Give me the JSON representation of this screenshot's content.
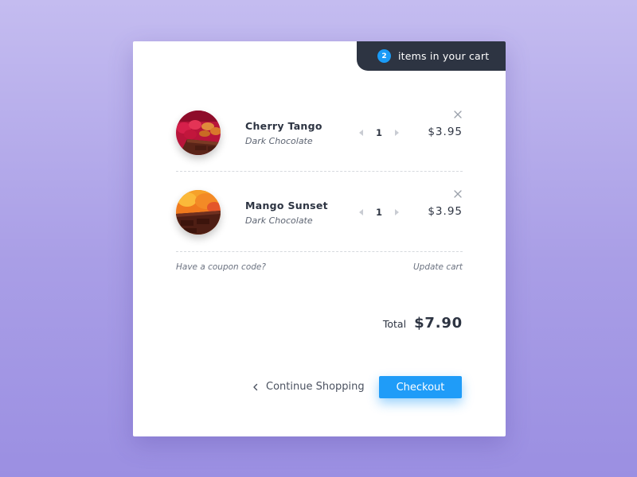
{
  "header": {
    "cart_count": "2",
    "cart_label": "items in your cart"
  },
  "items": [
    {
      "name": "Cherry Tango",
      "type": "Dark Chocolate",
      "quantity": "1",
      "price": "$3.95",
      "image_icon": "cherry-chocolate-image"
    },
    {
      "name": "Mango Sunset",
      "type": "Dark Chocolate",
      "quantity": "1",
      "price": "$3.95",
      "image_icon": "mango-chocolate-image"
    }
  ],
  "links": {
    "coupon": "Have a coupon code?",
    "update": "Update cart"
  },
  "total": {
    "label": "Total",
    "value": "$7.90"
  },
  "actions": {
    "continue": "Continue Shopping",
    "checkout": "Checkout"
  },
  "colors": {
    "accent": "#1f9cf8",
    "dark": "#2d3442",
    "background_top": "#c4bcf0",
    "background_bottom": "#9b8fe2"
  }
}
